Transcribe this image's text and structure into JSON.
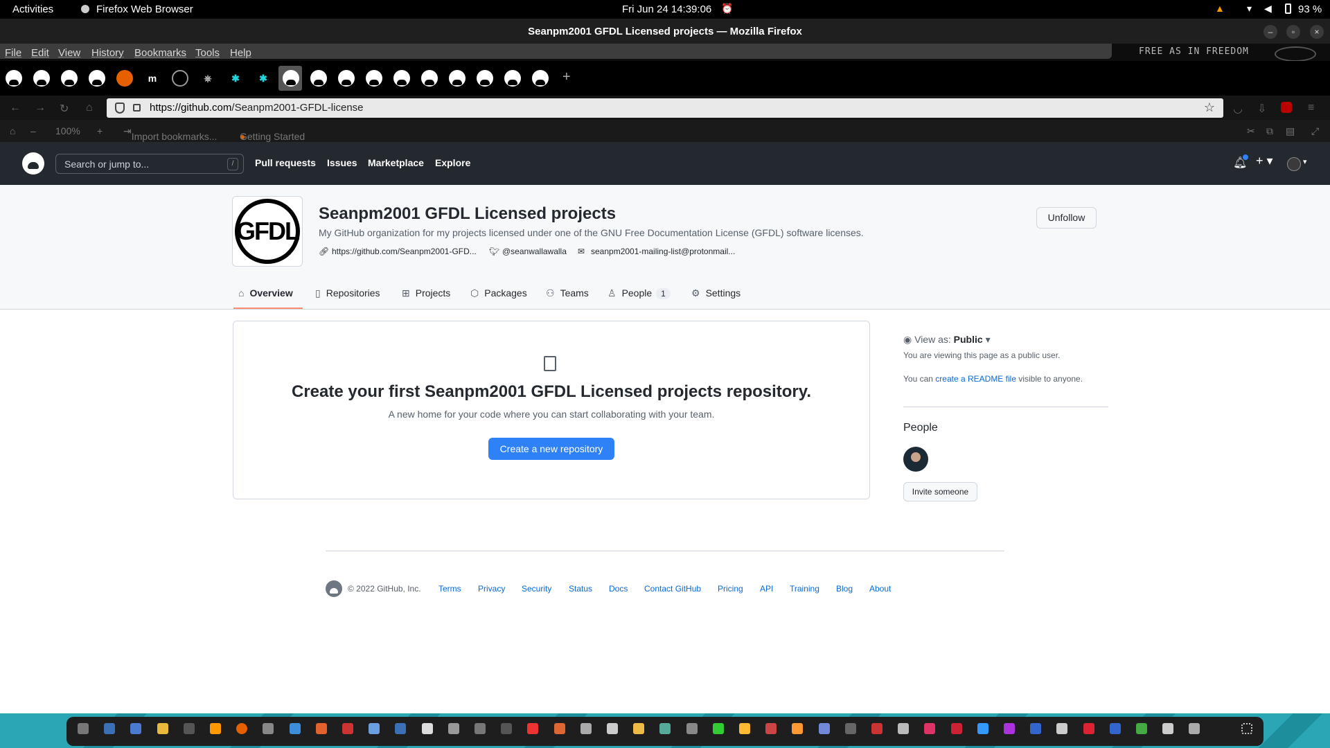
{
  "os": {
    "activities": "Activities",
    "app_name": "Firefox Web Browser",
    "clock": "Fri Jun 24  14:39:06",
    "battery": "93 %"
  },
  "window": {
    "title": "Seanpm2001 GFDL Licensed projects — Mozilla Firefox"
  },
  "menu": {
    "items": [
      "File",
      "Edit",
      "View",
      "History",
      "Bookmarks",
      "Tools",
      "Help"
    ],
    "theme_text": "FREE AS IN FREEDOM"
  },
  "browser": {
    "url_host": "https://github.com",
    "url_path": "/Seanpm2001-GFDL-license",
    "zoom": "100%",
    "bookmarks": [
      "Import bookmarks...",
      "Getting Started"
    ]
  },
  "github": {
    "search_placeholder": "Search or jump to...",
    "search_key": "/",
    "nav": [
      "Pull requests",
      "Issues",
      "Marketplace",
      "Explore"
    ]
  },
  "org": {
    "logo_text": "GFDL",
    "name": "Seanpm2001 GFDL Licensed projects",
    "description": "My GitHub organization for my projects licensed under one of the GNU Free Documentation License (GFDL) software licenses.",
    "website": "https://github.com/Seanpm2001-GFD...",
    "twitter": "@seanwallawalla",
    "email": "seanpm2001-mailing-list@protonmail...",
    "unfollow_label": "Unfollow",
    "tabs": [
      "Overview",
      "Repositories",
      "Projects",
      "Packages",
      "Teams",
      "People",
      "Settings"
    ],
    "people_count": "1"
  },
  "blankslate": {
    "heading": "Create your first Seanpm2001 GFDL Licensed projects repository.",
    "text": "A new home for your code where you can start collaborating with your team.",
    "button": "Create a new repository"
  },
  "sidebar": {
    "view_as_label": "View as:",
    "view_as_value": "Public",
    "public_note": "You are viewing this page as a public user.",
    "readme_prefix": "You can",
    "readme_link": "create a README file",
    "readme_suffix": "visible to anyone.",
    "people_heading": "People",
    "invite": "Invite someone"
  },
  "footer": {
    "copyright": "© 2022 GitHub, Inc.",
    "links": [
      "Terms",
      "Privacy",
      "Security",
      "Status",
      "Docs",
      "Contact GitHub",
      "Pricing",
      "API",
      "Training",
      "Blog",
      "About"
    ]
  }
}
